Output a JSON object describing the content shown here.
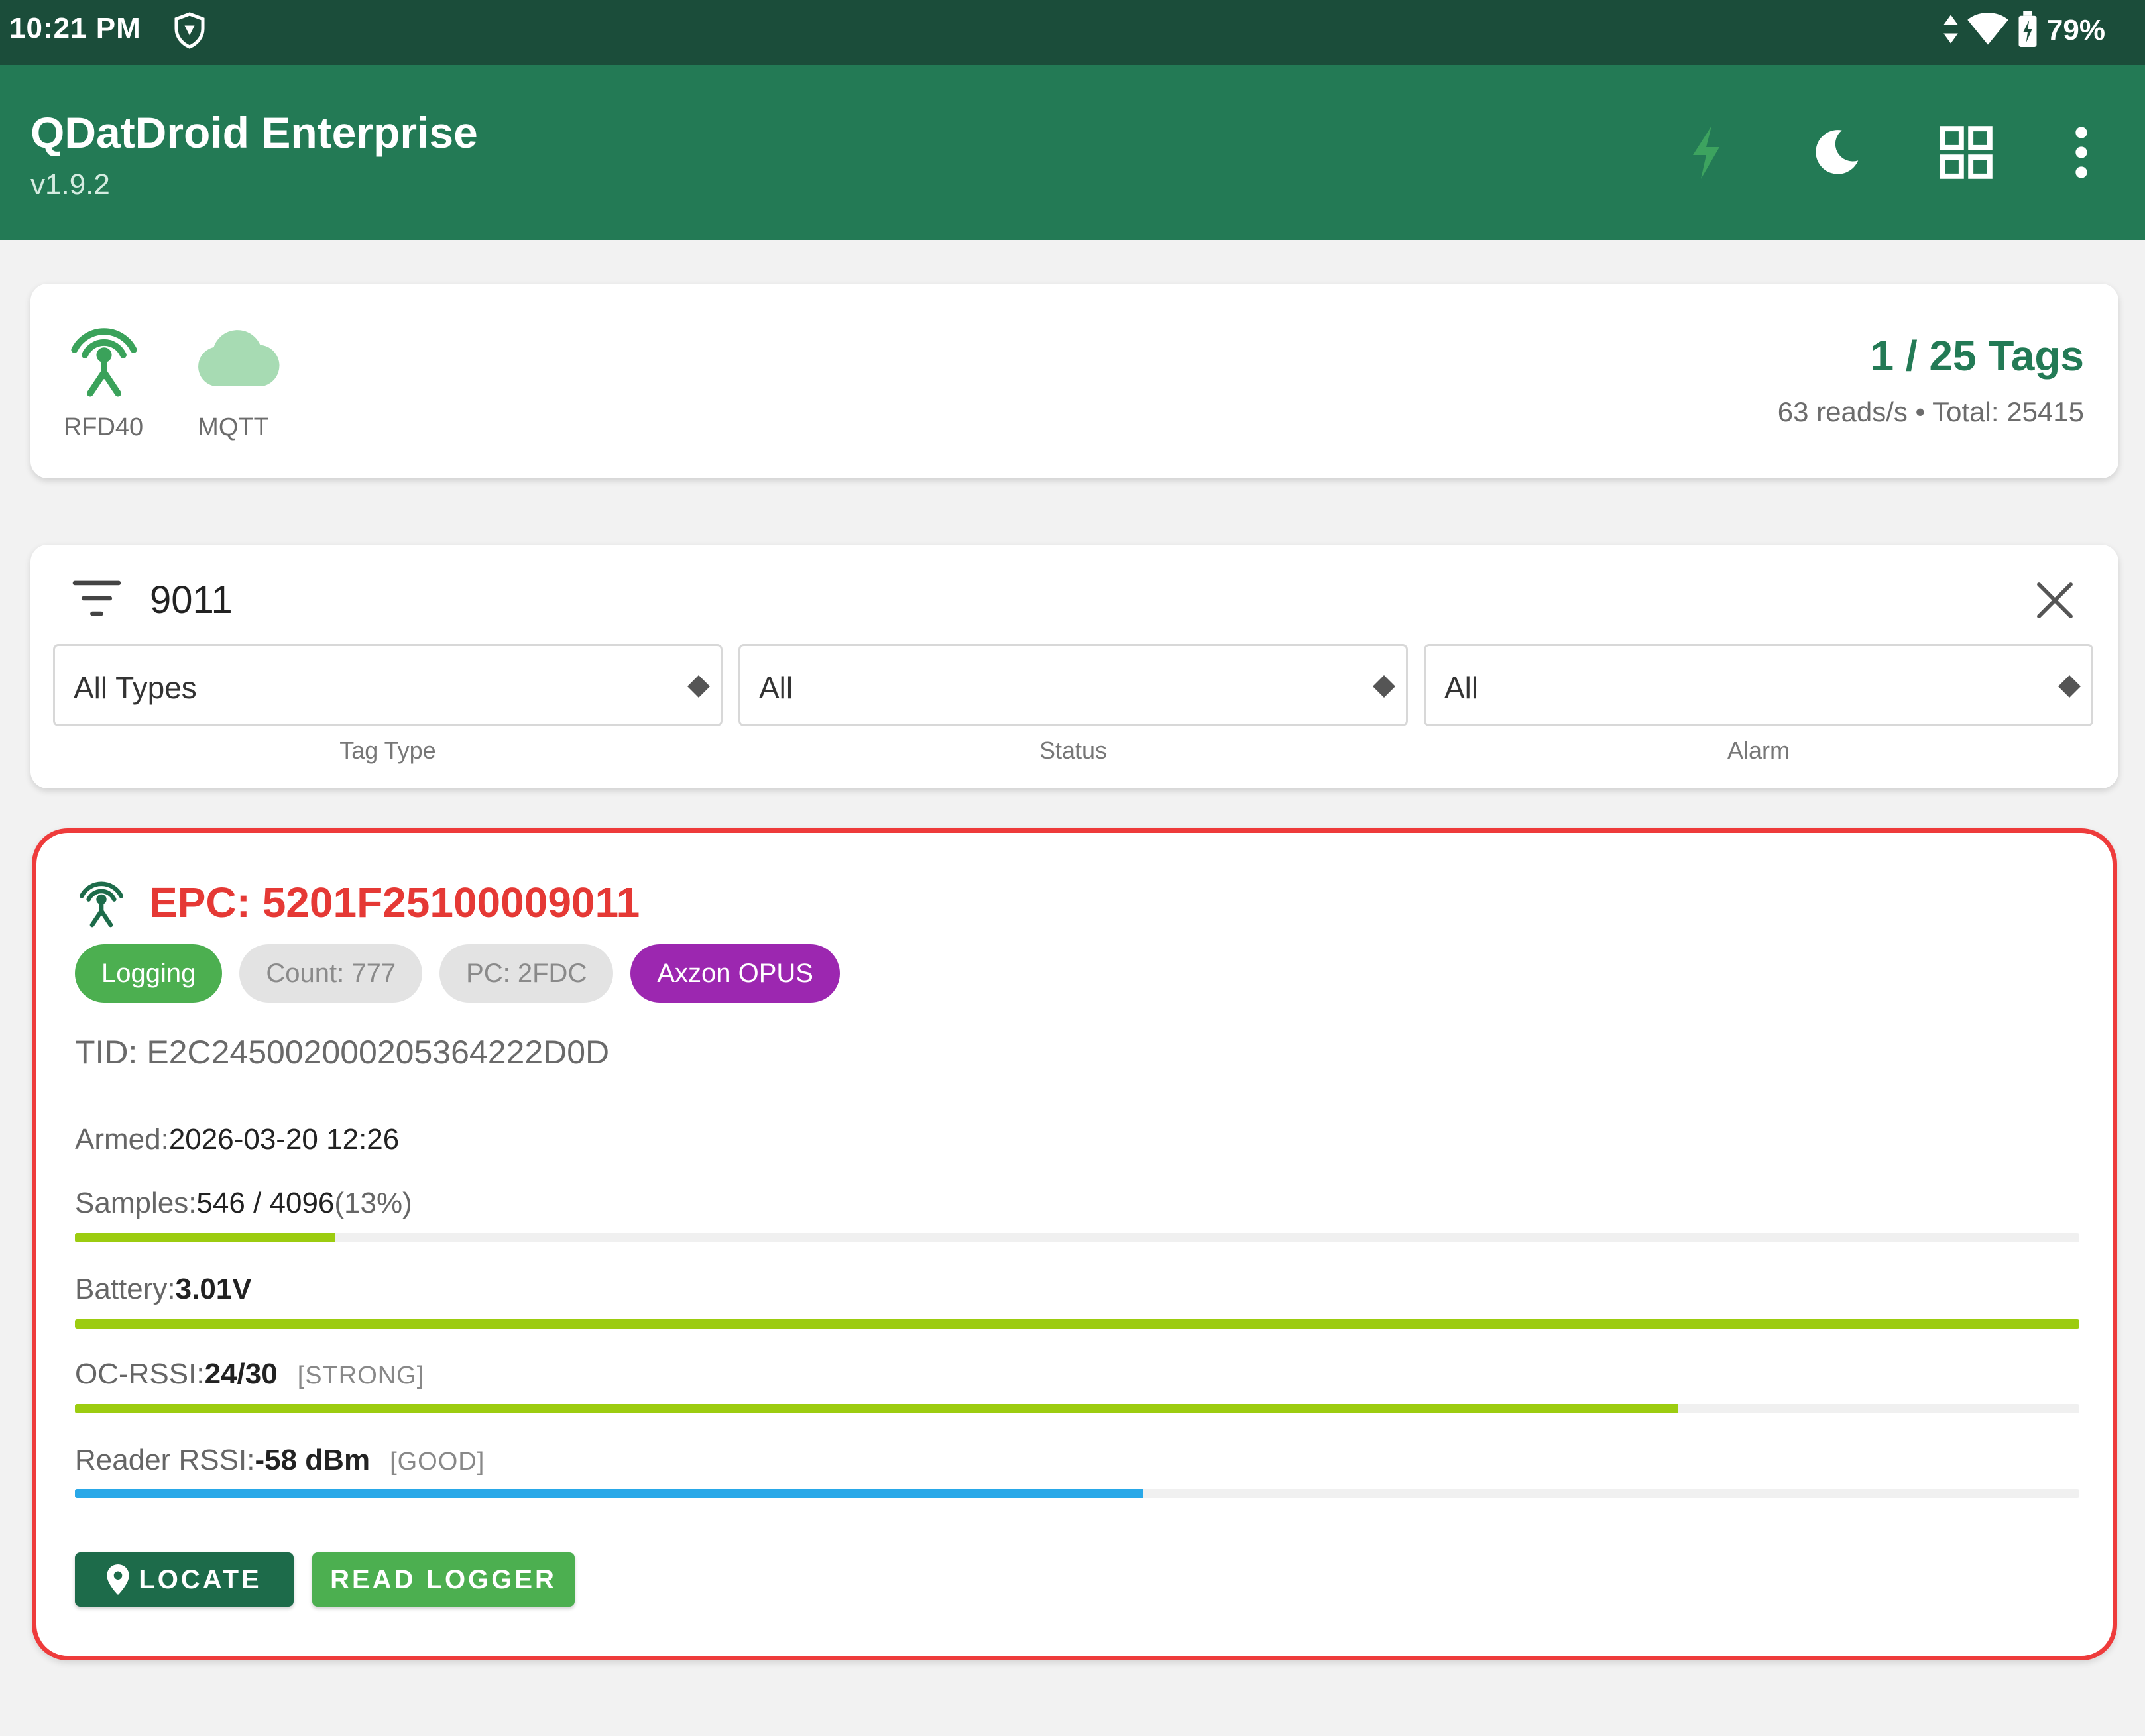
{
  "status_bar": {
    "time": "10:21 PM",
    "battery": "79%",
    "icons": [
      "vpn-shield-icon",
      "data-arrows-icon",
      "wifi-icon",
      "battery-icon"
    ]
  },
  "app_bar": {
    "title": "QDatDroid Enterprise",
    "version": "v1.9.2",
    "actions": [
      "flash-icon",
      "dark-mode-icon",
      "grid-view-icon",
      "more-vert-icon"
    ]
  },
  "summary": {
    "devices": [
      {
        "label": "RFD40",
        "icon": "antenna-icon"
      },
      {
        "label": "MQTT",
        "icon": "cloud-icon"
      }
    ],
    "tags_count": "1 / 25 Tags",
    "reads_line": "63 reads/s • Total: 25415"
  },
  "filter": {
    "query": "9011",
    "selects": [
      {
        "value": "All Types",
        "label": "Tag Type"
      },
      {
        "value": "All",
        "label": "Status"
      },
      {
        "value": "All",
        "label": "Alarm"
      }
    ]
  },
  "tag": {
    "epc": "EPC: 5201F25100009011",
    "chips": {
      "logging": "Logging",
      "count": "Count: 777",
      "pc": "PC: 2FDC",
      "chip_model": "Axzon OPUS"
    },
    "tid": "TID: E2C245002000205364222D0D",
    "armed": {
      "label": "Armed:",
      "value": "2026-03-20 12:26"
    },
    "samples": {
      "label": "Samples:",
      "value": "546 / 4096",
      "pct_text": "(13%)",
      "fraction": 0.13
    },
    "battery": {
      "label": "Battery:",
      "value": "3.01V",
      "fraction": 1.0
    },
    "oc_rssi": {
      "label": "OC-RSSI:",
      "value": "24/30",
      "quality": "[STRONG]",
      "fraction": 0.8
    },
    "reader_rssi": {
      "label": "Reader RSSI:",
      "value": "-58 dBm",
      "quality": "[GOOD]",
      "fraction": 0.533
    },
    "buttons": {
      "locate": "LOCATE",
      "read_logger": "READ LOGGER"
    }
  },
  "colors": {
    "status_bar": "#1b4d3a",
    "app_bar": "#237a55",
    "accent_green": "#4caf50",
    "alarm_red": "#e53935",
    "chip_purple": "#9c27b0",
    "bar_lime": "#9ccc10",
    "bar_blue": "#29a8e8"
  }
}
